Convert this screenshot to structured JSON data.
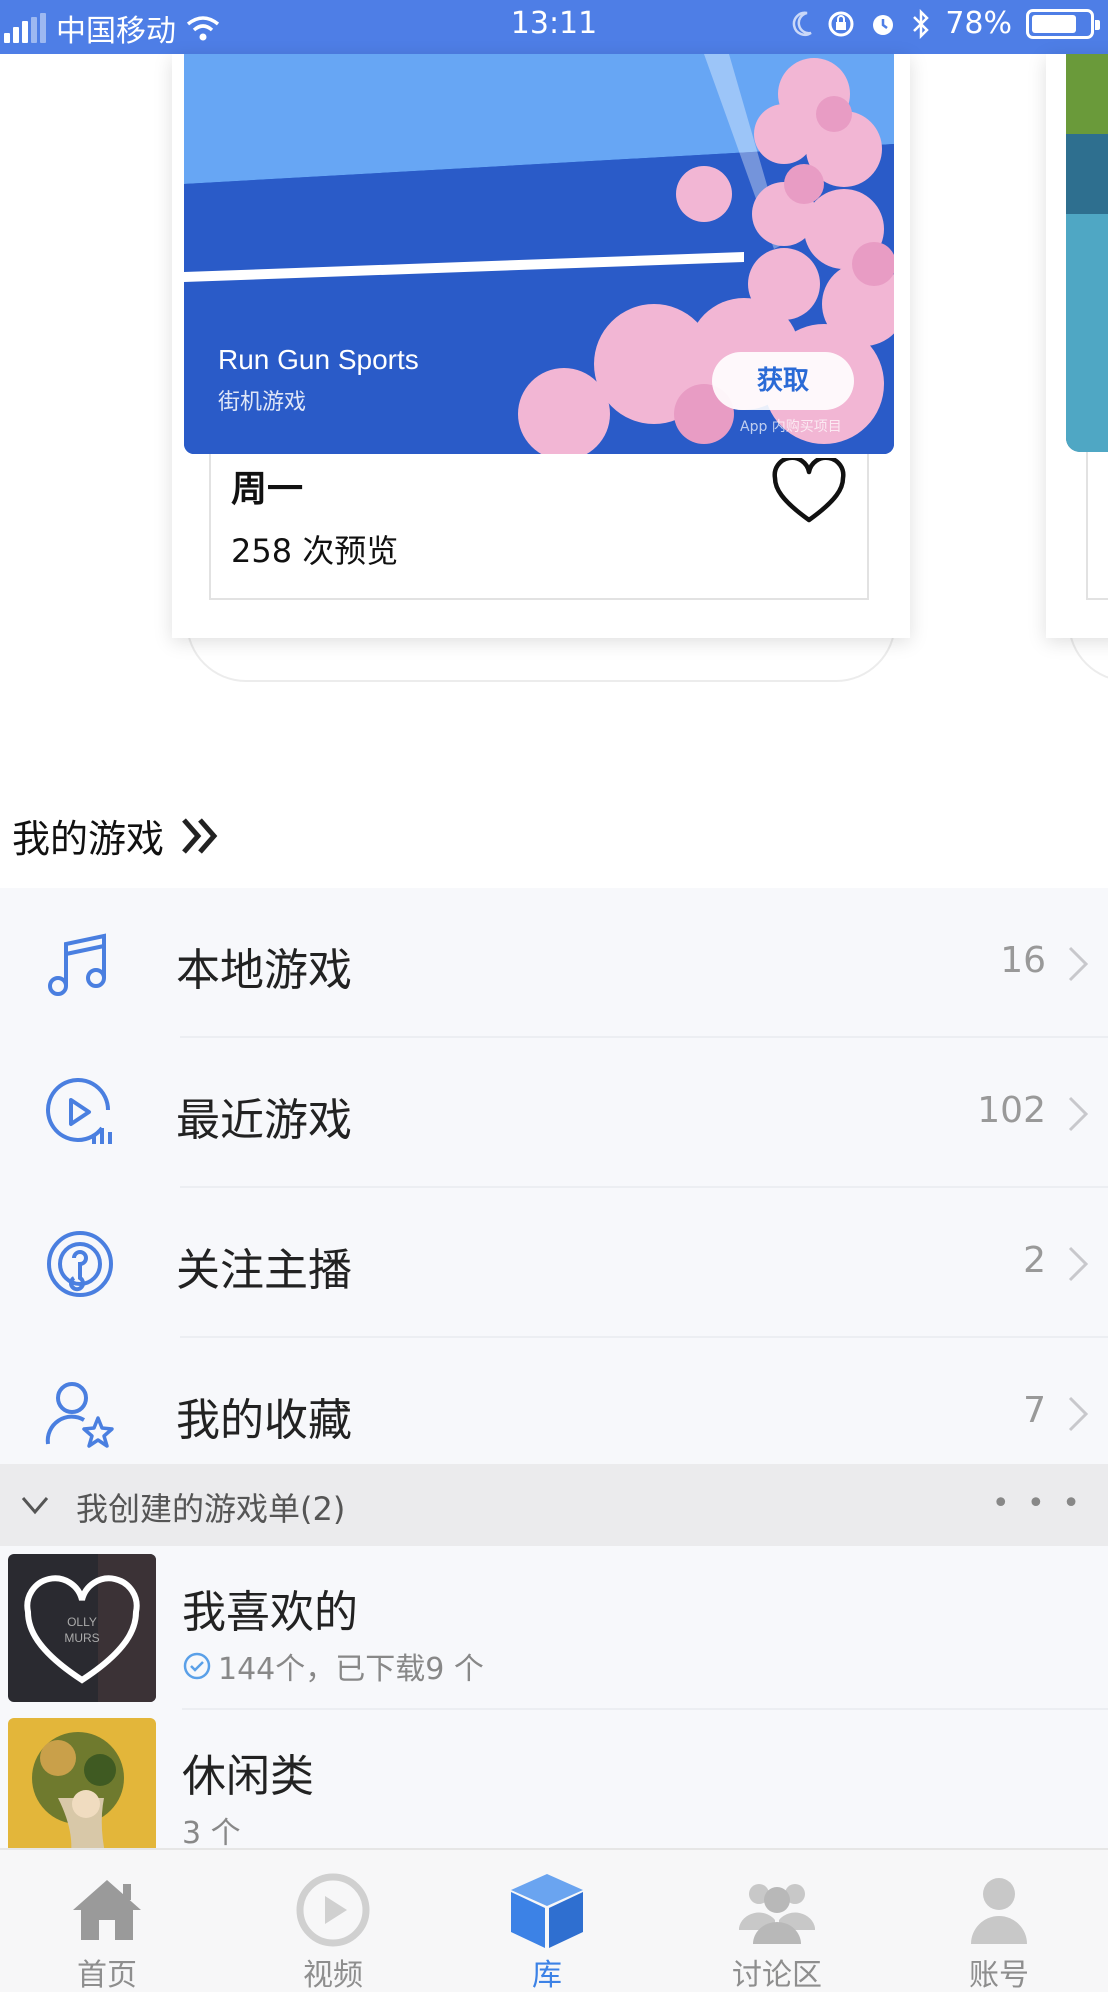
{
  "status_bar": {
    "carrier": "中国移动",
    "time": "13:11",
    "battery": "78%",
    "battery_level": 0.78
  },
  "featured_card": {
    "game_title": "Run Gun Sports",
    "genre": "街机游戏",
    "get_button": "获取",
    "iap_note": "App 内购买项目",
    "day": "周一",
    "views": "258 次预览"
  },
  "my_games": {
    "title": "我的游戏",
    "items": [
      {
        "icon": "music-note-icon",
        "label": "本地游戏",
        "count": "16"
      },
      {
        "icon": "play-circle-icon",
        "label": "最近游戏",
        "count": "102"
      },
      {
        "icon": "podcast-icon",
        "label": "关注主播",
        "count": "2"
      },
      {
        "icon": "user-star-icon",
        "label": "我的收藏",
        "count": "7"
      }
    ]
  },
  "playlists": {
    "header": "我创建的游戏单(2)",
    "more": "• • •",
    "items": [
      {
        "name": "我喜欢的",
        "meta": "144个，已下载9 个",
        "downloaded_icon": "check-circle-icon"
      },
      {
        "name": "休闲类",
        "meta": "3 个"
      }
    ]
  },
  "tab_bar": {
    "tabs": [
      {
        "label": "首页",
        "icon": "home-icon",
        "active": false
      },
      {
        "label": "视频",
        "icon": "play-icon",
        "active": false
      },
      {
        "label": "库",
        "icon": "cube-icon",
        "active": true
      },
      {
        "label": "讨论区",
        "icon": "group-icon",
        "active": false
      },
      {
        "label": "账号",
        "icon": "person-icon",
        "active": false
      }
    ]
  },
  "colors": {
    "status_bar": "#4e7ee6",
    "accent": "#3c82e6",
    "banner": "#2a5bc8"
  }
}
